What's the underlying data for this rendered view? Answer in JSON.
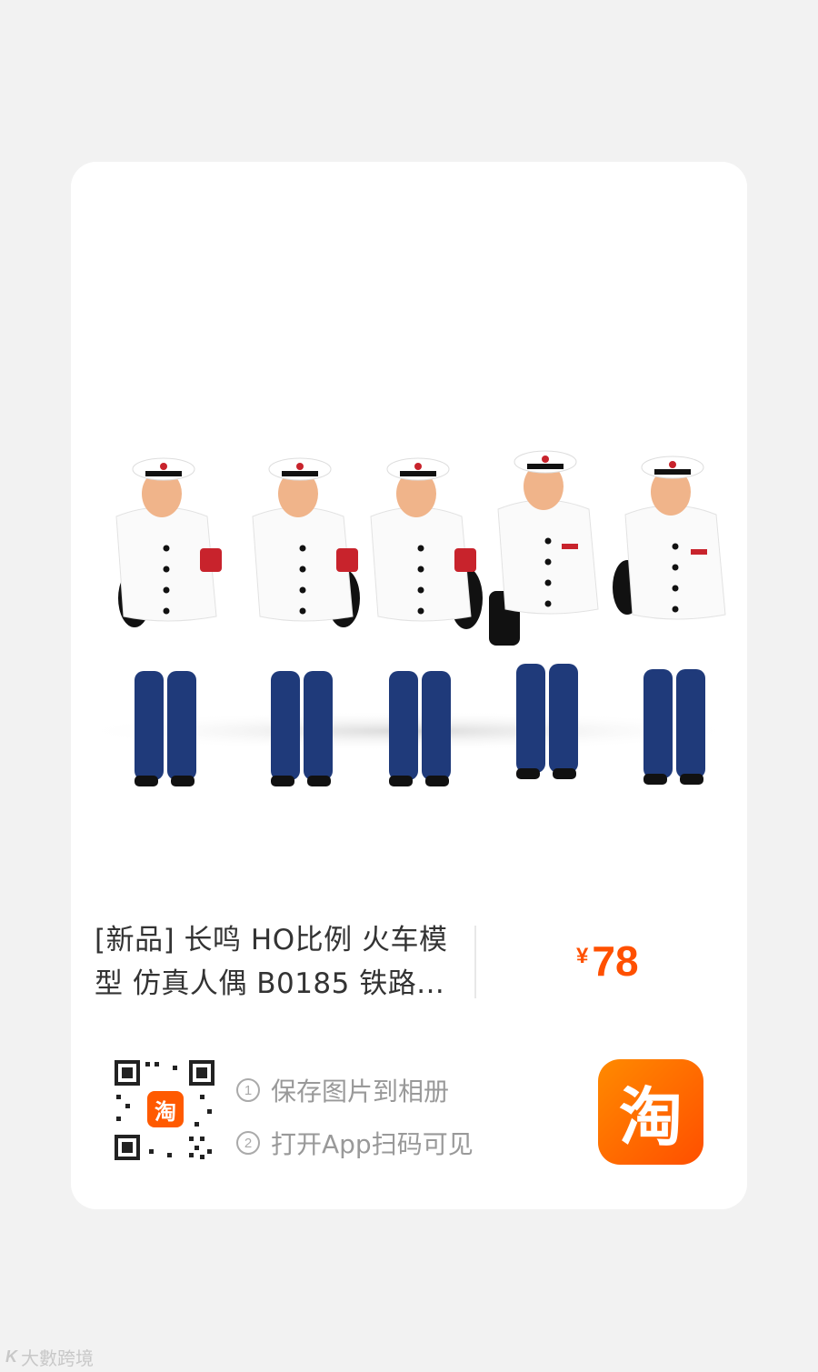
{
  "product": {
    "title": "[新品] 长鸣 HO比例 火车模型 仿真人偶 B0185 铁路...",
    "price_symbol": "¥",
    "price_value": "78",
    "image_alt": "five railway conductor figurines"
  },
  "share": {
    "qr_badge": "淘",
    "steps": [
      {
        "index": "1",
        "text": "保存图片到相册"
      },
      {
        "index": "2",
        "text": "打开App扫码可见"
      }
    ],
    "app_logo_char": "淘"
  },
  "watermark": {
    "icon": "K",
    "text": "大數跨境"
  },
  "colors": {
    "accent": "#ff5000",
    "background": "#f2f2f2",
    "card": "#ffffff"
  }
}
